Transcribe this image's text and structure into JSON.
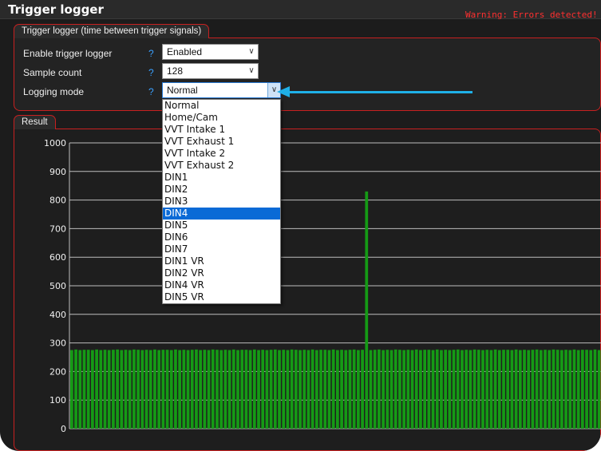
{
  "window": {
    "title": "Trigger logger",
    "warning": "Warning: Errors detected!"
  },
  "settings": {
    "tab_label": "Trigger logger (time between trigger signals)",
    "help_symbol": "?",
    "rows": [
      {
        "label": "Enable trigger logger",
        "value": "Enabled"
      },
      {
        "label": "Sample count",
        "value": "128"
      },
      {
        "label": "Logging mode",
        "value": "Normal"
      }
    ]
  },
  "dropdown": {
    "options": [
      "Normal",
      "Home/Cam",
      "VVT Intake 1",
      "VVT Exhaust 1",
      "VVT Intake 2",
      "VVT Exhaust 2",
      "DIN1",
      "DIN2",
      "DIN3",
      "DIN4",
      "DIN5",
      "DIN6",
      "DIN7",
      "DIN1 VR",
      "DIN2 VR",
      "DIN4 VR",
      "DIN5 VR"
    ],
    "highlighted": "DIN4"
  },
  "result": {
    "tab_label": "Result"
  },
  "colors": {
    "accent_border": "#c82020",
    "bar": "#159a15",
    "warning": "#ff3030",
    "help": "#3aa0ff",
    "arrow": "#1fb0e8",
    "highlight": "#0a6ad6"
  },
  "chart_data": {
    "type": "bar",
    "ylim": [
      0,
      1000
    ],
    "yticks": [
      0,
      100,
      200,
      300,
      400,
      500,
      600,
      700,
      800,
      900,
      1000
    ],
    "grid": true,
    "baseline_value": 275,
    "values": [
      275,
      277,
      275,
      276,
      276,
      275,
      277,
      275,
      276,
      275,
      276,
      277,
      275,
      276,
      275,
      277,
      276,
      275,
      276,
      275,
      277,
      275,
      276,
      276,
      275,
      277,
      275,
      276,
      275,
      276,
      277,
      275,
      276,
      275,
      277,
      276,
      275,
      276,
      275,
      277,
      275,
      276,
      276,
      275,
      277,
      275,
      276,
      275,
      276,
      277,
      275,
      276,
      275,
      277,
      276,
      275,
      276,
      275,
      277,
      275,
      276,
      276,
      275,
      277,
      275,
      276,
      275,
      276,
      277,
      275,
      276,
      830,
      275,
      276,
      277,
      275,
      276,
      275,
      277,
      276,
      275,
      276,
      275,
      277,
      275,
      276,
      276,
      275,
      277,
      275,
      276,
      275,
      276,
      277,
      275,
      276,
      275,
      277,
      276,
      275,
      276,
      275,
      277,
      275,
      276,
      276,
      275,
      277,
      275,
      276,
      275,
      276,
      277,
      275,
      276,
      275,
      277,
      276,
      275,
      276,
      275,
      277,
      275,
      276,
      276,
      275,
      277,
      275
    ]
  }
}
